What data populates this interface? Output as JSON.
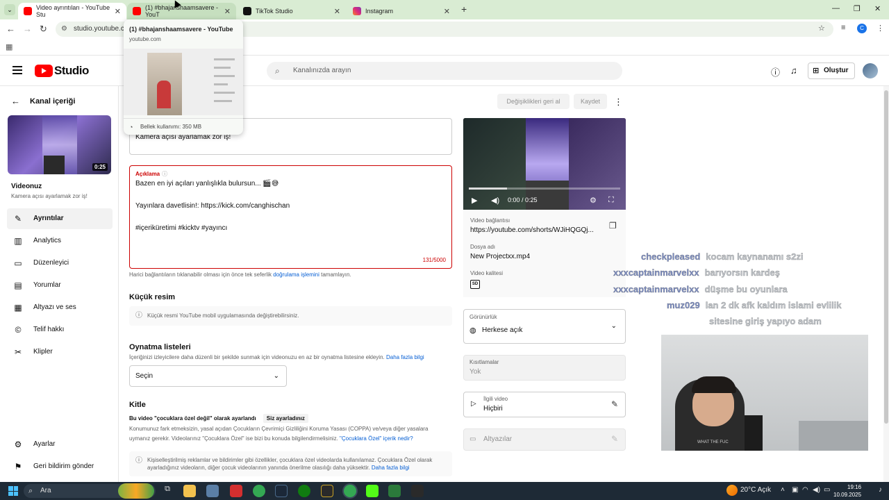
{
  "browser": {
    "tabs": [
      {
        "title": "Video ayrıntıları - YouTube Stu"
      },
      {
        "title": "(1) #bhajanshaamsavere - YouT"
      },
      {
        "title": "TikTok Studio"
      },
      {
        "title": "Instagram"
      }
    ],
    "new_tab": "+",
    "address": "studio.youtube.co",
    "controls": {
      "minimize": "—",
      "maximize": "❐",
      "close": "✕"
    },
    "profile_initial": "C"
  },
  "hover_card": {
    "title": "(1) #bhajanshaamsavere - YouTube",
    "url": "youtube.com",
    "memory": "Bellek kullanımı: 350 MB"
  },
  "header": {
    "logo_text": "Studio",
    "search_placeholder": "Kanalınızda arayın",
    "create_label": "Oluştur"
  },
  "sidebar": {
    "back_label": "Kanal içeriği",
    "thumb_duration": "0:25",
    "your_video_label": "Videonuz",
    "video_title": "Kamera açısı ayarlamak zor iş!",
    "items": [
      {
        "label": "Ayrıntılar",
        "icon": "✎"
      },
      {
        "label": "Analytics",
        "icon": "▥"
      },
      {
        "label": "Düzenleyici",
        "icon": "▭"
      },
      {
        "label": "Yorumlar",
        "icon": "▤"
      },
      {
        "label": "Altyazı ve ses",
        "icon": "▦"
      },
      {
        "label": "Telif hakkı",
        "icon": "©"
      },
      {
        "label": "Klipler",
        "icon": "✂"
      }
    ],
    "bottom_items": [
      {
        "label": "Ayarlar",
        "icon": "⚙"
      },
      {
        "label": "Geri bildirim gönder",
        "icon": "⚑"
      }
    ]
  },
  "actions": {
    "undo_label": "Değişiklikleri geri al",
    "save_label": "Kaydet"
  },
  "form": {
    "title_value": "Kamera açısı ayarlamak zor iş!",
    "description_label": "Açıklama",
    "description_lines": [
      "Bazen en iyi açıları yanlışlıkla bulursun... 🎬😅",
      "Yayınlara davetlisin!: https://kick.com/canghischan",
      "#içeriküretimi #kicktv #yayıncı"
    ],
    "description_count": "131/5000",
    "links_help_prefix": "Harici bağlantıların tıklanabilir olması için önce tek seferlik ",
    "links_help_link": "doğrulama işlemini",
    "links_help_suffix": " tamamlayın.",
    "thumbnail_heading": "Küçük resim",
    "thumbnail_info": "Küçük resmi YouTube mobil uygulamasında değiştirebilirsiniz.",
    "playlists_heading": "Oynatma listeleri",
    "playlists_desc": "İçeriğinizi izleyicilere daha düzenli bir şekilde sunmak için videonuzu en az bir oynatma listesine ekleyin. ",
    "playlists_link": "Daha fazla bilgi",
    "playlists_select": "Seçin",
    "audience_heading": "Kitle",
    "audience_status": "Bu video \"çocuklara özel değil\" olarak ayarlandı",
    "audience_badge": "Siz ayarladınız",
    "audience_desc_1": "Konumunuz fark etmeksizin, yasal açıdan Çocukların Çevrimiçi Gizliliğini Koruma Yasası (COPPA) ve/veya diğer yasalara",
    "audience_desc_2": "uymanız gerekir. Videolarınız \"Çocuklara Özel\" ise bizi bu konuda bilgilendirmelisiniz. ",
    "audience_link": "\"Çocuklara Özel\" içerik nedir?",
    "audience_info_1": "Kişiselleştirilmiş reklamlar ve bildirimler gibi özellikler, çocuklara özel videolarda kullanılamaz. Çocuklara Özel olarak",
    "audience_info_2": "ayarladığınız videoların, diğer çocuk videolarının yanında önerilme olasılığı daha yüksektir. ",
    "audience_info_link": "Daha fazla bilgi"
  },
  "player": {
    "time": "0:00 / 0:25",
    "progress": 0.25,
    "video_link_label": "Video bağlantısı",
    "video_link": "https://youtube.com/shorts/WJiHQGQj...",
    "filename_label": "Dosya adı",
    "filename": "New Projectxx.mp4",
    "quality_label": "Video kalitesi",
    "quality_badge": "SD"
  },
  "right_fields": {
    "visibility_label": "Görünürlük",
    "visibility_value": "Herkese açık",
    "restrictions_label": "Kısıtlamalar",
    "restrictions_value": "Yok",
    "related_label": "İlgili video",
    "related_value": "Hiçbiri",
    "subtitles_label": "Altyazılar"
  },
  "stream_chat": [
    {
      "user": "checkpleased",
      "msg": "kocam kaynanamı s2zi"
    },
    {
      "user": "xxxcaptainmarvelxx",
      "msg": "barıyorsın kardeş"
    },
    {
      "user": "xxxcaptainmarvelxx",
      "msg": "düşme bu oyunlara"
    },
    {
      "user": "muz029",
      "msg": "lan 2 dk afk kaldım islami evlilik"
    },
    {
      "user": "",
      "msg": "sitesine giriş yapıyo adam"
    }
  ],
  "webcam_shirt_text": "WHAT THE FUC",
  "taskbar": {
    "search_label": "Ara",
    "weather": "20°C  Açık",
    "time": "19:16",
    "date": "10.09.2025"
  },
  "colors": {
    "accent_red": "#ff0000",
    "link_blue": "#065fd4",
    "error_red": "#cc0000",
    "tab_green": "#d9ecd3"
  }
}
